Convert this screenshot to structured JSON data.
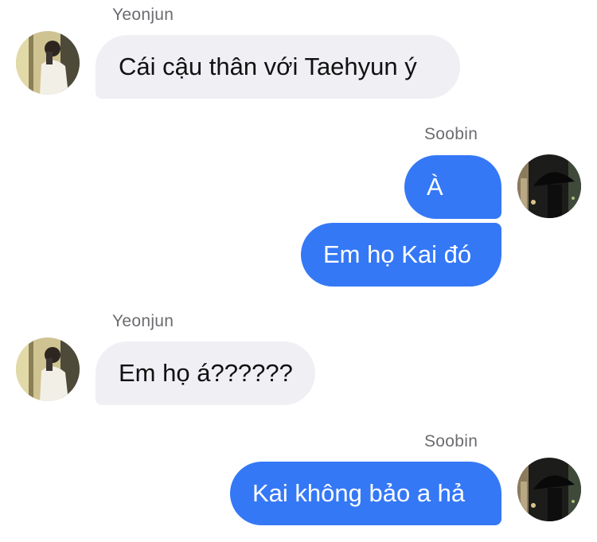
{
  "messages": [
    {
      "sender": "Yeonjun",
      "direction": "incoming",
      "bubbles": [
        "Cái cậu thân với Taehyun ý"
      ]
    },
    {
      "sender": "Soobin",
      "direction": "outgoing",
      "bubbles": [
        "À",
        "Em họ Kai đó"
      ]
    },
    {
      "sender": "Yeonjun",
      "direction": "incoming",
      "bubbles": [
        "Em họ á??????"
      ]
    },
    {
      "sender": "Soobin",
      "direction": "outgoing",
      "bubbles": [
        "Kai không bảo a hả"
      ]
    }
  ],
  "colors": {
    "incoming_bubble": "#efeff4",
    "outgoing_bubble": "#3478f6",
    "sender_name": "#6b6b70"
  },
  "avatars": {
    "Yeonjun": "person-photo-avatar-yeonjun",
    "Soobin": "person-with-umbrella-avatar-soobin"
  }
}
